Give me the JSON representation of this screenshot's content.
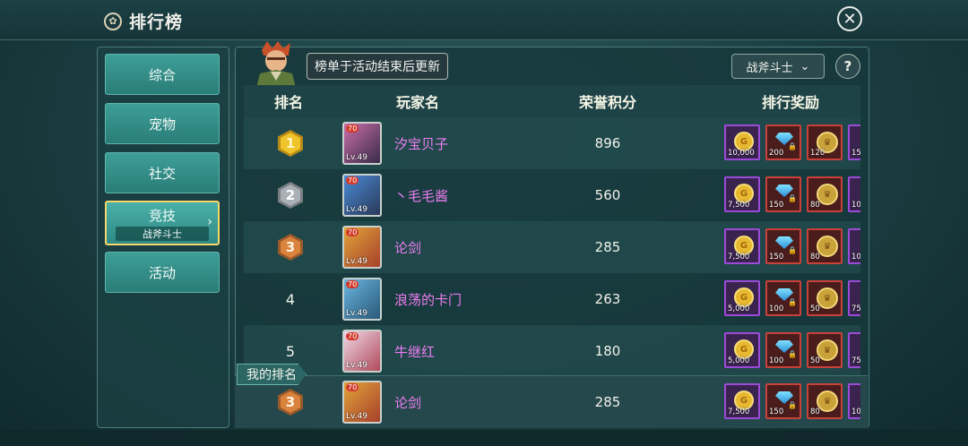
{
  "header": {
    "title": "排行榜",
    "title_icon": "settings-icon",
    "close_icon": "close-icon"
  },
  "sidebar": {
    "items": [
      {
        "label": "综合"
      },
      {
        "label": "宠物"
      },
      {
        "label": "社交"
      },
      {
        "label": "竞技",
        "sub": "战斧斗士",
        "active": true
      },
      {
        "label": "活动"
      }
    ]
  },
  "notice": "榜单于活动结束后更新",
  "filter": {
    "selected": "战斧斗士",
    "help": "?"
  },
  "table": {
    "headers": {
      "rank": "排名",
      "player": "玩家名",
      "score": "荣誉积分",
      "reward": "排行奖励"
    },
    "rows": [
      {
        "rank": "1",
        "level": "Lv.49",
        "name": "汐宝贝子",
        "score": "896",
        "rewards": [
          "10,000",
          "200",
          "120",
          "15"
        ]
      },
      {
        "rank": "2",
        "level": "Lv.49",
        "name": "丶毛毛酱",
        "score": "560",
        "rewards": [
          "7,500",
          "150",
          "80",
          "10"
        ]
      },
      {
        "rank": "3",
        "level": "Lv.49",
        "name": "论剑",
        "score": "285",
        "rewards": [
          "7,500",
          "150",
          "80",
          "10"
        ]
      },
      {
        "rank": "4",
        "level": "Lv.49",
        "name": "浪荡的卡门",
        "score": "263",
        "rewards": [
          "5,000",
          "100",
          "50",
          "75"
        ]
      },
      {
        "rank": "5",
        "level": "Lv.49",
        "name": "牛继红",
        "score": "180",
        "rewards": [
          "5,000",
          "100",
          "50",
          "75"
        ]
      }
    ]
  },
  "my_rank": {
    "label": "我的排名",
    "rank": "3",
    "level": "Lv.49",
    "name": "论剑",
    "score": "285",
    "rewards": [
      "7,500",
      "150",
      "80",
      "10"
    ]
  },
  "colors": {
    "accent": "#f4d66a",
    "name_color": "#ec7df1",
    "bg": "#1a3c40"
  }
}
